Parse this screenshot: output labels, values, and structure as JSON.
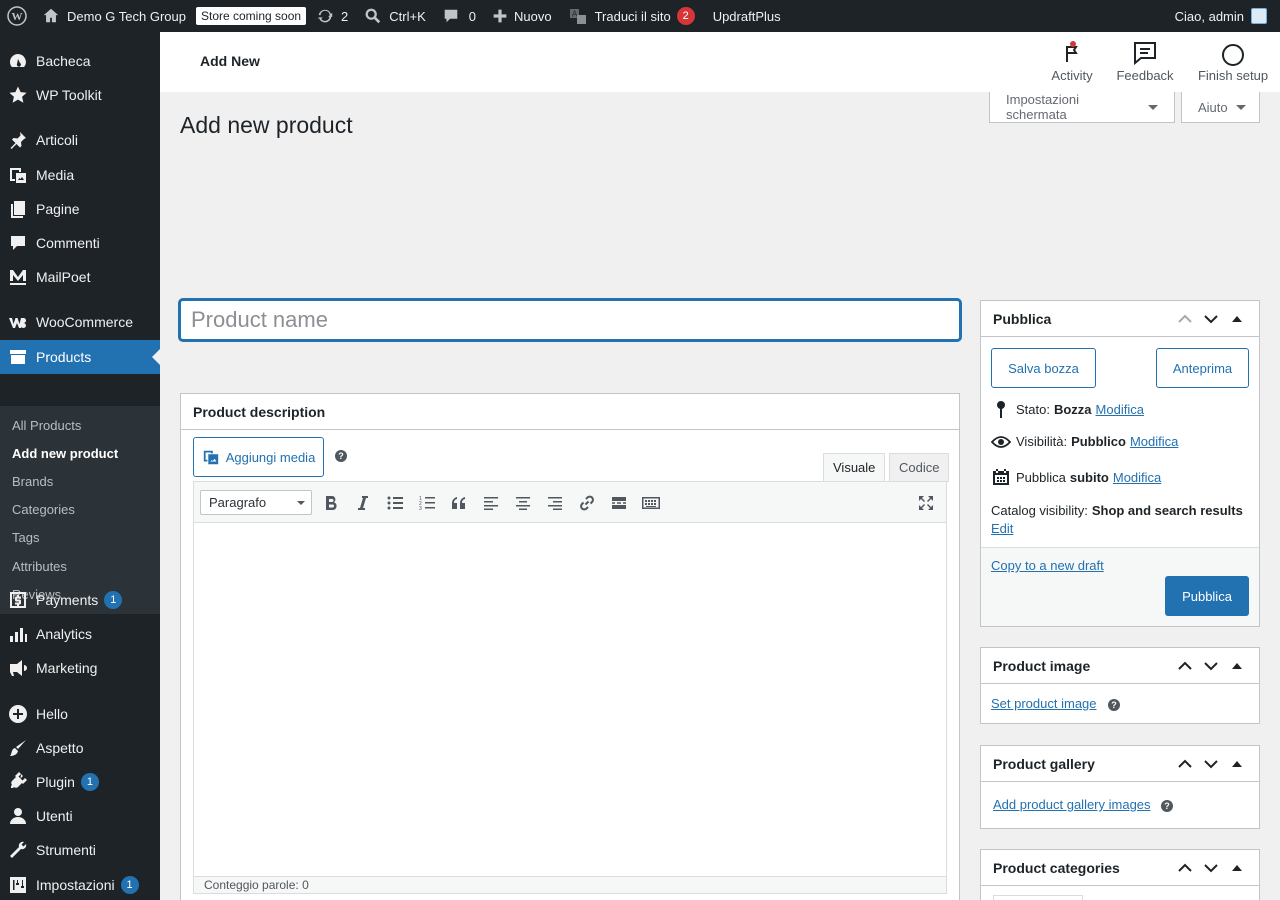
{
  "admin_bar": {
    "site_name": "Demo G Tech Group",
    "store_badge": "Store coming soon",
    "updates_count": "2",
    "search_shortcut": "Ctrl+K",
    "comments_count": "0",
    "new_label": "Nuovo",
    "translate_label": "Traduci il sito",
    "translate_count": "2",
    "updraft_label": "UpdraftPlus",
    "greeting": "Ciao, admin"
  },
  "sidebar": {
    "items": [
      {
        "label": "Bacheca",
        "icon": "dashboard-icon"
      },
      {
        "label": "WP Toolkit",
        "icon": "star-icon"
      },
      {
        "label": "Articoli",
        "icon": "pin-icon"
      },
      {
        "label": "Media",
        "icon": "media-icon"
      },
      {
        "label": "Pagine",
        "icon": "pages-icon"
      },
      {
        "label": "Commenti",
        "icon": "comment-icon"
      },
      {
        "label": "MailPoet",
        "icon": "mailpoet-icon"
      },
      {
        "label": "WooCommerce",
        "icon": "woo-icon"
      },
      {
        "label": "Products",
        "icon": "archive-icon"
      },
      {
        "label": "Payments",
        "icon": "payments-icon",
        "badge": "1"
      },
      {
        "label": "Analytics",
        "icon": "chart-icon"
      },
      {
        "label": "Marketing",
        "icon": "megaphone-icon"
      },
      {
        "label": "Hello",
        "icon": "plus-circle-icon"
      },
      {
        "label": "Aspetto",
        "icon": "brush-icon"
      },
      {
        "label": "Plugin",
        "icon": "plugin-icon",
        "badge": "1"
      },
      {
        "label": "Utenti",
        "icon": "users-icon"
      },
      {
        "label": "Strumenti",
        "icon": "wrench-icon"
      },
      {
        "label": "Impostazioni",
        "icon": "settings-icon",
        "badge": "1"
      }
    ],
    "submenu": [
      "All Products",
      "Add new product",
      "Brands",
      "Categories",
      "Tags",
      "Attributes",
      "Reviews"
    ]
  },
  "header": {
    "title": "Add New",
    "activity": "Activity",
    "feedback": "Feedback",
    "finish_setup": "Finish setup"
  },
  "screen_options": {
    "options_label": "Impostazioni schermata",
    "help_label": "Aiuto"
  },
  "page": {
    "title": "Add new product",
    "product_name_placeholder": "Product name"
  },
  "description_box": {
    "title": "Product description",
    "add_media": "Aggiungi media",
    "tab_visual": "Visuale",
    "tab_code": "Codice",
    "format_select": "Paragrafo",
    "word_count": "Conteggio parole: 0"
  },
  "publish_box": {
    "title": "Pubblica",
    "save_draft": "Salva bozza",
    "preview": "Anteprima",
    "status_label": "Stato:",
    "status_value": "Bozza",
    "visibility_label": "Visibilità:",
    "visibility_value": "Pubblico",
    "publish_label": "Pubblica",
    "publish_value": "subito",
    "edit_link": "Modifica",
    "catalog_label": "Catalog visibility:",
    "catalog_value": "Shop and search results",
    "catalog_edit": "Edit",
    "copy_draft": "Copy to a new draft",
    "publish_button": "Pubblica"
  },
  "product_image_box": {
    "title": "Product image",
    "set_image": "Set product image"
  },
  "product_gallery_box": {
    "title": "Product gallery",
    "add_images": "Add product gallery images"
  },
  "product_categories_box": {
    "title": "Product categories"
  }
}
